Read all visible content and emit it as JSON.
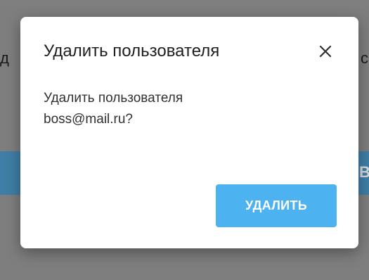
{
  "background": {
    "left_text_fragment": "д",
    "right_text_fragment": "с",
    "band_text_fragment": "В"
  },
  "dialog": {
    "title": "Удалить пользователя",
    "close_icon": "close-icon",
    "message_line1": "Удалить пользователя",
    "message_line2": "boss@mail.ru?",
    "delete_label": "УДАЛИТЬ"
  },
  "colors": {
    "overlay": "#7e7e7e",
    "band": "#3f7ea6",
    "dialog_bg": "#ffffff",
    "primary_button": "#4db2f0",
    "title_text": "#202020"
  }
}
